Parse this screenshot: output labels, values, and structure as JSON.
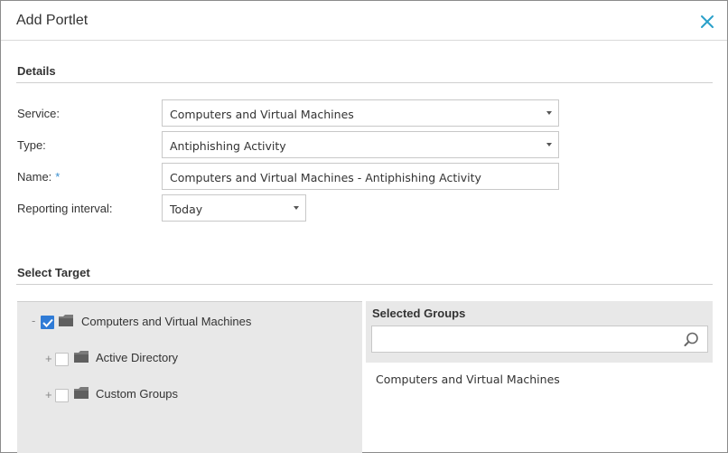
{
  "dialog": {
    "title": "Add Portlet",
    "close_icon": "close-icon"
  },
  "details": {
    "heading": "Details",
    "service_label": "Service:",
    "service_value": "Computers and Virtual Machines",
    "type_label": "Type:",
    "type_value": "Antiphishing Activity",
    "name_label": "Name:",
    "name_required": "*",
    "name_value": "Computers and Virtual Machines - Antiphishing Activity",
    "interval_label": "Reporting interval:",
    "interval_value": "Today"
  },
  "target": {
    "heading": "Select Target",
    "tree": [
      {
        "expander": "-",
        "label": "Computers and Virtual Machines",
        "checked": true
      },
      {
        "expander": "+",
        "label": "Active Directory",
        "checked": false
      },
      {
        "expander": "+",
        "label": "Custom Groups",
        "checked": false
      }
    ],
    "selected_heading": "Selected Groups",
    "search_value": "",
    "selected_items": [
      "Computers and Virtual Machines"
    ]
  },
  "colors": {
    "accent": "#2f7bd6",
    "close_icon": "#2aa0c9",
    "panel_bg": "#e8e8e8"
  }
}
